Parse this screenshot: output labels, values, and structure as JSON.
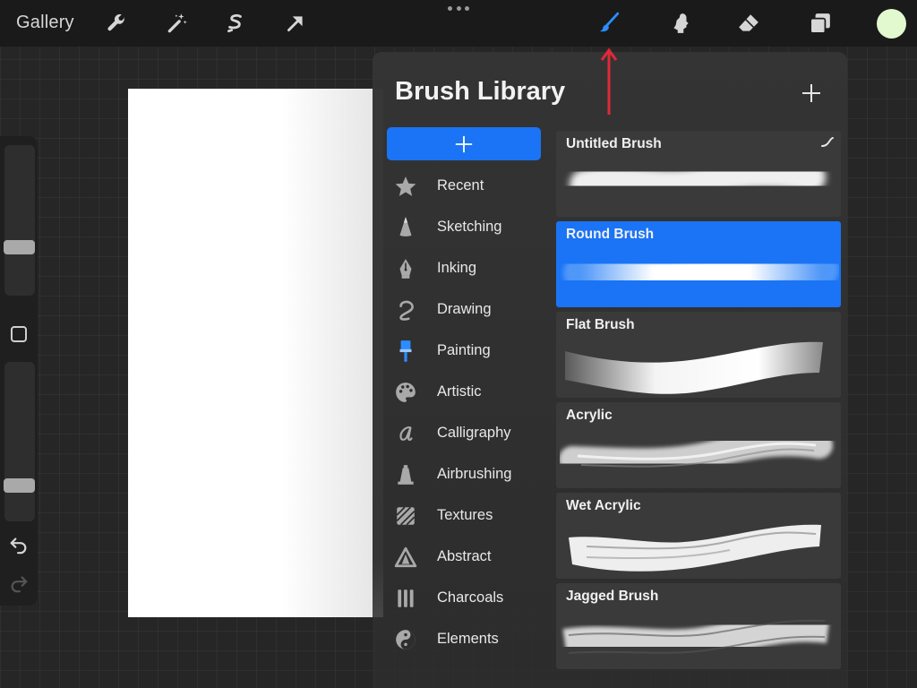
{
  "toolbar": {
    "gallery_label": "Gallery",
    "tools": [
      "wrench-icon",
      "magic-wand-icon",
      "selection-icon",
      "transform-arrow-icon",
      "brush-icon",
      "smudge-icon",
      "eraser-icon",
      "layers-icon"
    ],
    "active_tool": "brush-icon",
    "active_color": "#e2f8cf"
  },
  "sidebar": {
    "size_slider_value": 0.3,
    "opacity_slider_value": 0.2,
    "buttons": [
      "modify-square-icon",
      "undo-icon",
      "redo-icon"
    ]
  },
  "brush_library": {
    "title": "Brush Library",
    "sets": [
      {
        "label": "Recent",
        "icon": "star-icon"
      },
      {
        "label": "Sketching",
        "icon": "pencil-tip-icon"
      },
      {
        "label": "Inking",
        "icon": "pen-nib-icon"
      },
      {
        "label": "Drawing",
        "icon": "squiggle-icon"
      },
      {
        "label": "Painting",
        "icon": "paint-brush-icon"
      },
      {
        "label": "Artistic",
        "icon": "palette-icon"
      },
      {
        "label": "Calligraphy",
        "icon": "script-a-icon"
      },
      {
        "label": "Airbrushing",
        "icon": "airbrush-icon"
      },
      {
        "label": "Textures",
        "icon": "texture-icon"
      },
      {
        "label": "Abstract",
        "icon": "triangle-icon"
      },
      {
        "label": "Charcoals",
        "icon": "charcoal-sticks-icon"
      },
      {
        "label": "Elements",
        "icon": "yin-yang-icon"
      }
    ],
    "brushes": [
      {
        "name": "Untitled Brush",
        "selected": false
      },
      {
        "name": "Round Brush",
        "selected": true
      },
      {
        "name": "Flat Brush",
        "selected": false
      },
      {
        "name": "Acrylic",
        "selected": false
      },
      {
        "name": "Wet Acrylic",
        "selected": false
      },
      {
        "name": "Jagged Brush",
        "selected": false
      }
    ]
  },
  "colors": {
    "accent": "#1a74f5",
    "annotation_arrow": "#e0283a"
  }
}
